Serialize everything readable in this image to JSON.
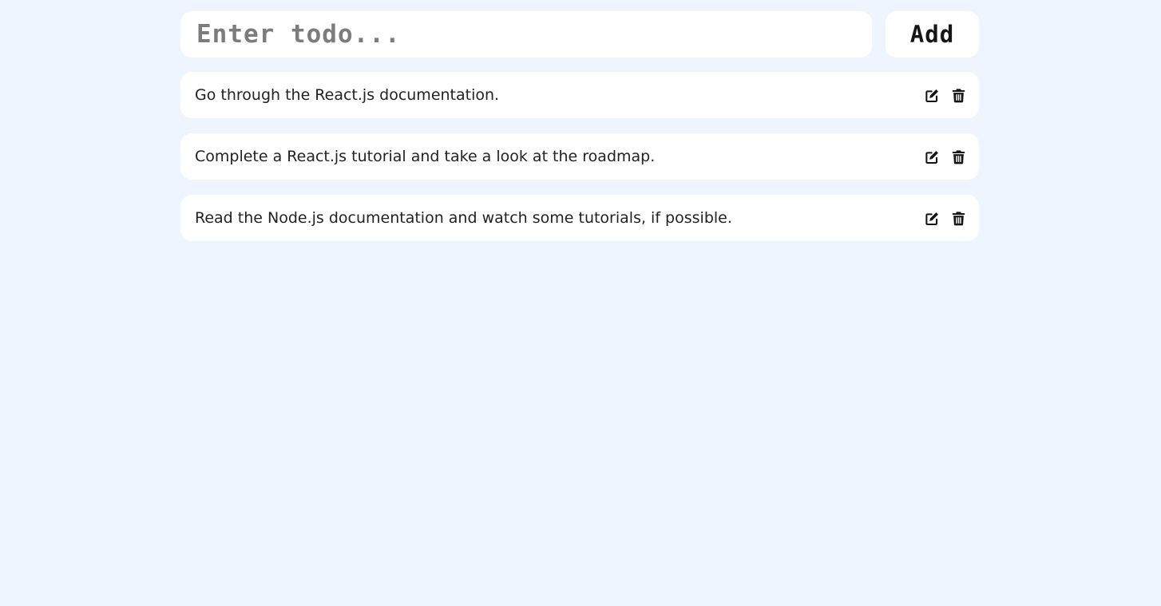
{
  "input": {
    "placeholder": "Enter todo...",
    "value": ""
  },
  "add_button": {
    "label": "Add"
  },
  "todos": [
    {
      "text": "Go through the React.js documentation.",
      "edit_icon": "edit-icon",
      "delete_icon": "trash-icon"
    },
    {
      "text": "Complete a React.js tutorial and take a look at the roadmap.",
      "edit_icon": "edit-icon",
      "delete_icon": "trash-icon"
    },
    {
      "text": "Read the Node.js documentation and watch some tutorials, if possible.",
      "edit_icon": "edit-icon",
      "delete_icon": "trash-icon"
    }
  ],
  "colors": {
    "background": "#eef5ff",
    "card": "#ffffff",
    "text": "#222222",
    "placeholder": "#7c7c7c"
  }
}
